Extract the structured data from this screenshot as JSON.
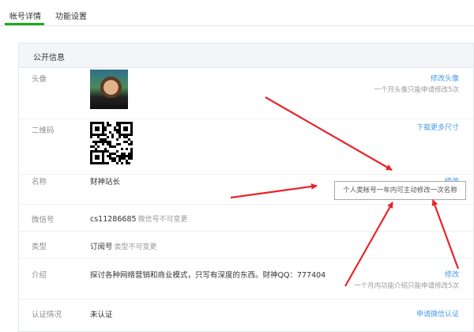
{
  "tabs": [
    {
      "label": "帐号详情",
      "active": true
    },
    {
      "label": "功能设置",
      "active": false
    }
  ],
  "section_title": "公开信息",
  "rows": {
    "avatar": {
      "label": "头像",
      "action": "修改头像",
      "hint": "一个月头像只能申请修改5次"
    },
    "qrcode": {
      "label": "二维码",
      "action": "下载更多尺寸"
    },
    "name": {
      "label": "名称",
      "value": "财神站长",
      "action": "修改"
    },
    "wechat_id": {
      "label": "微信号",
      "value": "cs11286685",
      "tip": "微信号不可变更"
    },
    "type": {
      "label": "类型",
      "value": "订阅号",
      "tip": "类型不可变更"
    },
    "intro": {
      "label": "介绍",
      "value": "探讨各种网络营销和商业模式，只写有深度的东西。财神QQ：777404",
      "action": "修改",
      "hint": "一个月内功能介绍只能申请修改5次"
    },
    "verify": {
      "label": "认证情况",
      "value": "未认证",
      "action": "申请微信认证"
    }
  },
  "tooltip": "个人类帐号一年内可主动修改一次名称",
  "colors": {
    "accent_green": "#1aad19",
    "link_blue": "#459ae9",
    "arrow_red": "#e8242a"
  }
}
